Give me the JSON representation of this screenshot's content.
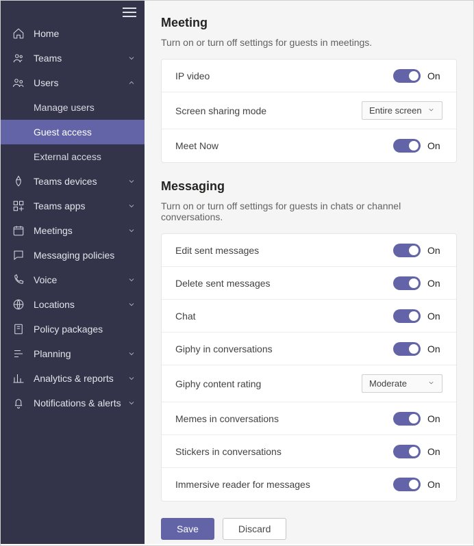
{
  "sidebar": {
    "items": [
      {
        "label": "Home",
        "icon": "home"
      },
      {
        "label": "Teams",
        "icon": "teams",
        "expandable": true
      },
      {
        "label": "Users",
        "icon": "users",
        "expandable": true,
        "expanded": true,
        "children": [
          {
            "label": "Manage users"
          },
          {
            "label": "Guest access",
            "selected": true
          },
          {
            "label": "External access"
          }
        ]
      },
      {
        "label": "Teams devices",
        "icon": "devices",
        "expandable": true
      },
      {
        "label": "Teams apps",
        "icon": "apps",
        "expandable": true
      },
      {
        "label": "Meetings",
        "icon": "meetings",
        "expandable": true
      },
      {
        "label": "Messaging policies",
        "icon": "messaging"
      },
      {
        "label": "Voice",
        "icon": "voice",
        "expandable": true
      },
      {
        "label": "Locations",
        "icon": "locations",
        "expandable": true
      },
      {
        "label": "Policy packages",
        "icon": "policy"
      },
      {
        "label": "Planning",
        "icon": "planning",
        "expandable": true
      },
      {
        "label": "Analytics & reports",
        "icon": "analytics",
        "expandable": true
      },
      {
        "label": "Notifications & alerts",
        "icon": "notifications",
        "expandable": true
      }
    ]
  },
  "sections": {
    "meeting": {
      "title": "Meeting",
      "desc": "Turn on or turn off settings for guests in meetings.",
      "rows": [
        {
          "label": "IP video",
          "type": "toggle",
          "value": "On"
        },
        {
          "label": "Screen sharing mode",
          "type": "select",
          "value": "Entire screen"
        },
        {
          "label": "Meet Now",
          "type": "toggle",
          "value": "On"
        }
      ]
    },
    "messaging": {
      "title": "Messaging",
      "desc": "Turn on or turn off settings for guests in chats or channel conversations.",
      "rows": [
        {
          "label": "Edit sent messages",
          "type": "toggle",
          "value": "On"
        },
        {
          "label": "Delete sent messages",
          "type": "toggle",
          "value": "On"
        },
        {
          "label": "Chat",
          "type": "toggle",
          "value": "On"
        },
        {
          "label": "Giphy in conversations",
          "type": "toggle",
          "value": "On"
        },
        {
          "label": "Giphy content rating",
          "type": "select",
          "value": "Moderate"
        },
        {
          "label": "Memes in conversations",
          "type": "toggle",
          "value": "On"
        },
        {
          "label": "Stickers in conversations",
          "type": "toggle",
          "value": "On"
        },
        {
          "label": "Immersive reader for messages",
          "type": "toggle",
          "value": "On"
        }
      ]
    }
  },
  "footer": {
    "save": "Save",
    "discard": "Discard"
  }
}
